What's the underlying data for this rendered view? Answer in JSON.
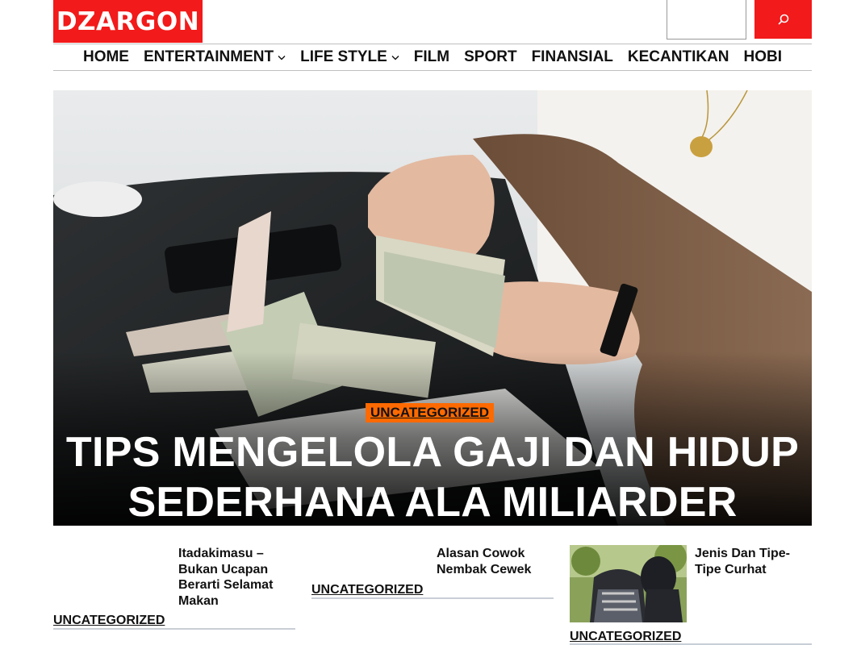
{
  "header": {
    "logo_text": "DZARGON",
    "search_placeholder": "",
    "search_icon": "search-icon",
    "brand_color": "#f21a1a"
  },
  "nav": {
    "items": [
      {
        "label": "HOME"
      },
      {
        "label": "ENTERTAINMENT",
        "has_dropdown": true
      },
      {
        "label": "LIFE STYLE",
        "has_dropdown": true
      },
      {
        "label": "FILM"
      },
      {
        "label": "SPORT"
      },
      {
        "label": "FINANSIAL"
      },
      {
        "label": "KECANTIKAN"
      },
      {
        "label": "HOBI"
      }
    ]
  },
  "hero": {
    "category": "UNCATEGORIZED",
    "category_color": "#ff6a00",
    "title_line1": "TIPS MENGELOLA GAJI DAN HIDUP",
    "title_line2": "SEDERHANA ALA MILIARDER"
  },
  "cards": [
    {
      "title": "Itadakimasu – Bukan Ucapan Berarti Selamat Makan",
      "category": "UNCATEGORIZED"
    },
    {
      "title": "Alasan Cowok Nembak Cewek",
      "category": "UNCATEGORIZED"
    },
    {
      "title": "Jenis Dan Tipe-Tipe Curhat",
      "category": "UNCATEGORIZED"
    }
  ]
}
